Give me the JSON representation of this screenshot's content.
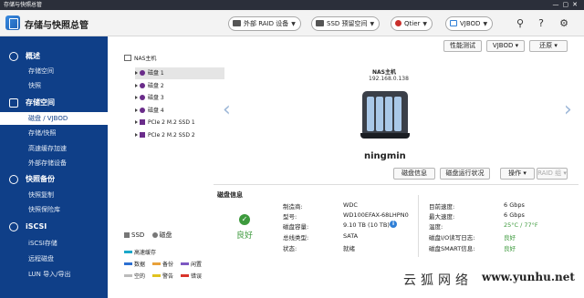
{
  "window": {
    "title": "存储与快照总管"
  },
  "header": {
    "app_title": "存储与快照总管",
    "buttons": [
      {
        "label": "外部 RAID 设备"
      },
      {
        "label": "SSD 预留空间"
      },
      {
        "label": "Qtier"
      },
      {
        "label": "VJBOD"
      }
    ]
  },
  "sidebar": {
    "sections": [
      {
        "label": "概述",
        "items": [
          "存储空间",
          "快照"
        ]
      },
      {
        "label": "存储空间",
        "items": [
          "磁盘 / VJBOD",
          "存储/快照",
          "高速缓存加速",
          "外部存储设备"
        ]
      },
      {
        "label": "快照备份",
        "items": [
          "快照复制",
          "快照保险库"
        ]
      },
      {
        "label": "iSCSI",
        "items": [
          "iSCSI存储",
          "远程磁盘",
          "LUN 导入/导出"
        ]
      }
    ],
    "active_item": "磁盘 / VJBOD"
  },
  "toolbar": {
    "benchmark": "性能测试",
    "vjbod": "VJBOD",
    "restore": "还原"
  },
  "tree": {
    "root": "NAS主机",
    "nodes": [
      {
        "label": "磁盘 1",
        "kind": "disk"
      },
      {
        "label": "磁盘 2",
        "kind": "disk"
      },
      {
        "label": "磁盘 3",
        "kind": "disk"
      },
      {
        "label": "磁盘 4",
        "kind": "disk"
      },
      {
        "label": "PCIe 2 M.2 SSD 1",
        "kind": "ssd"
      },
      {
        "label": "PCIe 2 M.2 SSD 2",
        "kind": "ssd"
      }
    ]
  },
  "legend": {
    "type_ssd": "SSD",
    "type_disk": "磁盘",
    "items": [
      {
        "label": "高速缓存",
        "color": "#1aa7c9"
      },
      {
        "label": "数据",
        "color": "#2c6fd1"
      },
      {
        "label": "备份",
        "color": "#e8a13a"
      },
      {
        "label": "闲置",
        "color": "#7c58c2"
      },
      {
        "label": "空的",
        "color": "#bbbbbb"
      },
      {
        "label": "警告",
        "color": "#e0c21e"
      },
      {
        "label": "错误",
        "color": "#d9342b"
      }
    ]
  },
  "device": {
    "name": "NAS主机",
    "ip": "192.168.0.138",
    "host": "ningmin"
  },
  "actions": {
    "disk_info": "磁盘信息",
    "disk_health": "磁盘运行状况",
    "operation": "操作",
    "raid_group": "RAID 组"
  },
  "disk_info": {
    "title": "磁盘信息",
    "health": "良好",
    "left": [
      {
        "label": "制造商:",
        "value": "WDC"
      },
      {
        "label": "型号:",
        "value": "WD100EFAX-68LHPN0"
      },
      {
        "label": "磁盘容量:",
        "value": "9.10 TB (10 TB)"
      },
      {
        "label": "总线类型:",
        "value": "SATA"
      },
      {
        "label": "状态:",
        "value": "就绪"
      }
    ],
    "right": [
      {
        "label": "目前速度:",
        "value": "6 Gbps"
      },
      {
        "label": "最大速度:",
        "value": "6 Gbps"
      },
      {
        "label": "温度:",
        "value": "25°C / 77°F"
      },
      {
        "label": "磁盘I/O读写日志:",
        "value": "良好"
      },
      {
        "label": "磁盘SMART信息:",
        "value": "良好"
      }
    ]
  },
  "watermark": {
    "cn": "云狐网络",
    "en": "www.yunhu.net"
  }
}
